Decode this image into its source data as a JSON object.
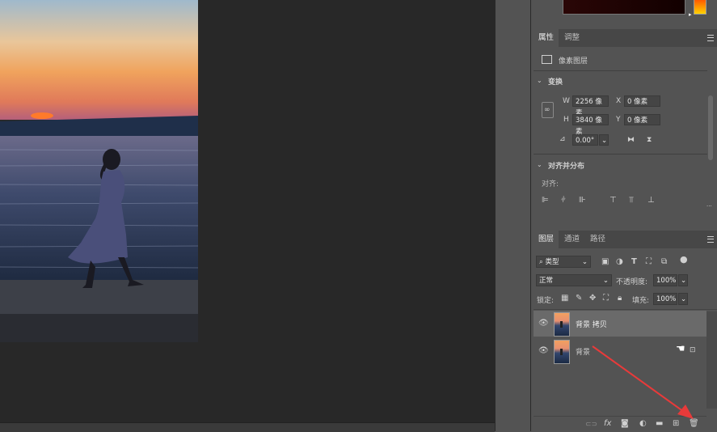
{
  "properties_panel": {
    "tabs": [
      "属性",
      "调整"
    ],
    "layer_kind": "像素图层",
    "transform": {
      "section_title": "变换",
      "w_label": "W",
      "w_value": "2256 像素",
      "x_label": "X",
      "x_value": "0 像素",
      "h_label": "H",
      "h_value": "3840 像素",
      "y_label": "Y",
      "y_value": "0 像素",
      "angle_value": "0.00°"
    },
    "align": {
      "section_title": "对齐并分布",
      "label": "对齐:"
    }
  },
  "layers_panel": {
    "tabs": [
      "图层",
      "通道",
      "路径"
    ],
    "filter_kind": "类型",
    "blend_mode": "正常",
    "opacity_label": "不透明度:",
    "opacity_value": "100%",
    "lock_label": "锁定:",
    "fill_label": "填充:",
    "fill_value": "100%",
    "layers": [
      {
        "name": "背景 拷贝",
        "selected": true,
        "locked": false
      },
      {
        "name": "背景",
        "selected": false,
        "locked": true
      }
    ],
    "footer_icons": [
      "link-icon",
      "fx-icon",
      "mask-icon",
      "adjustment-icon",
      "folder-icon",
      "new-layer-icon",
      "trash-icon"
    ],
    "fx_text": "fx"
  },
  "colors": {
    "panel_bg": "#535353",
    "workspace_bg": "#282828",
    "selected_row": "#6a6a6a",
    "annotation_arrow": "#e83a3a"
  }
}
